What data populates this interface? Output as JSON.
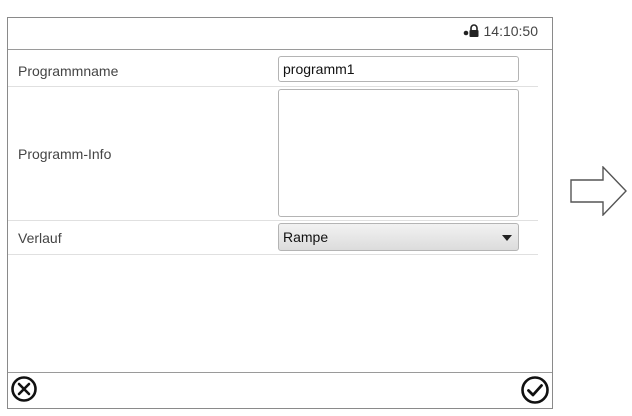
{
  "status_bar": {
    "lock_icon": "lock-icon",
    "time": "14:10:50"
  },
  "form": {
    "program_name": {
      "label": "Programmname",
      "value": "programm1"
    },
    "program_info": {
      "label": "Programm-Info",
      "value": ""
    },
    "profile": {
      "label": "Verlauf",
      "selected": "Rampe"
    }
  },
  "bottom_bar": {
    "cancel_icon": "cancel-x-icon",
    "confirm_icon": "confirm-check-icon"
  },
  "side": {
    "next_icon": "right-arrow-icon"
  }
}
